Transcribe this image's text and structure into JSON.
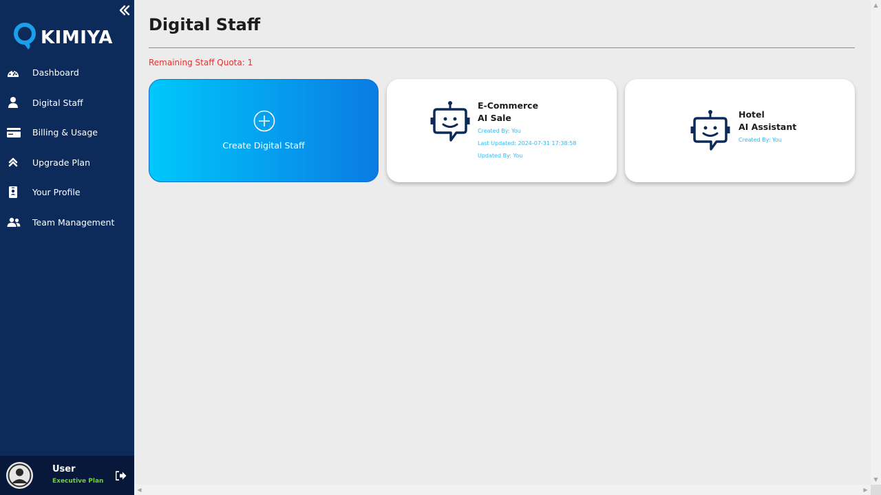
{
  "app": {
    "brand": "KIMIYA"
  },
  "sidebar": {
    "items": [
      {
        "label": "Dashboard",
        "icon": "dashboard-icon"
      },
      {
        "label": "Digital Staff",
        "icon": "user-icon"
      },
      {
        "label": "Billing & Usage",
        "icon": "credit-card-icon"
      },
      {
        "label": "Upgrade Plan",
        "icon": "upgrade-icon"
      },
      {
        "label": "Your Profile",
        "icon": "id-badge-icon"
      },
      {
        "label": "Team Management",
        "icon": "team-icon"
      }
    ],
    "user": {
      "name": "User",
      "plan": "Executive Plan"
    }
  },
  "main": {
    "title": "Digital Staff",
    "quota": "Remaining Staff Quota: 1",
    "create_label": "Create Digital Staff",
    "staff": [
      {
        "name_line1": "E-Commerce",
        "name_line2": "AI Sale",
        "created_by": "Created By: You",
        "last_updated": "Last Updated: 2024-07-31 17:38:58",
        "updated_by": "Updated By: You"
      },
      {
        "name_line1": "Hotel",
        "name_line2": "AI Assistant",
        "created_by": "Created By: You"
      }
    ]
  },
  "colors": {
    "sidebar_bg": "#0c2b5b",
    "accent_cyan": "#00c8fb",
    "accent_blue": "#0a7be3",
    "quota_red": "#e53030",
    "meta_blue": "#2fb8f0",
    "plan_green": "#6fd52b"
  }
}
